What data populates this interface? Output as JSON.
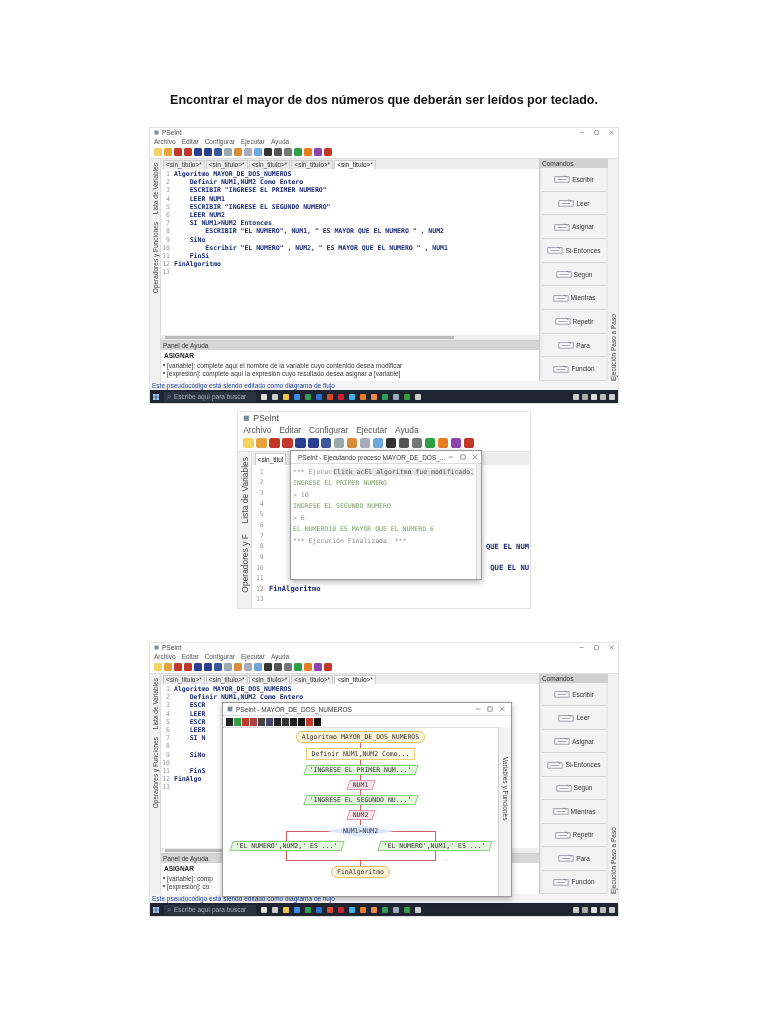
{
  "heading": "Encontrar el mayor de dos números que deberán ser leídos por teclado.",
  "screenshots": [
    {
      "window_title": "PSeInt",
      "menu": [
        "Archivo",
        "Editar",
        "Configurar",
        "Ejecutar",
        "Ayuda"
      ],
      "tabs": [
        {
          "label": "<sin_titulo>*",
          "selected": false
        },
        {
          "label": "<sin_titulo>*",
          "selected": false
        },
        {
          "label": "<sin_titulo>*",
          "selected": false
        },
        {
          "label": "<sin_titulo>*",
          "selected": false
        },
        {
          "label": "<sin_titulo>*",
          "selected": true
        }
      ],
      "left_strip": [
        "Lista de Variables",
        "Operadores y Funciones"
      ],
      "code_lines": [
        {
          "number": "1",
          "text": "Algoritmo MAYOR_DE_DOS_NUMEROS"
        },
        {
          "number": "2",
          "text": "    Definir NUM1,NUM2 Como Entero"
        },
        {
          "number": "3",
          "text": "    ESCRIBIR \"INGRESE EL PRIMER NUMERO\""
        },
        {
          "number": "4",
          "text": "    LEER NUM1"
        },
        {
          "number": "5",
          "text": "    ESCRIBIR \"INGRESE EL SEGUNDO NUMERO\""
        },
        {
          "number": "6",
          "text": "    LEER NUM2"
        },
        {
          "number": "7",
          "text": "    SI NUM1>NUM2 Entonces"
        },
        {
          "number": "8",
          "text": "        ESCRIBIR \"EL NUMERO\", NUM1, \" ES MAYOR QUE EL NUMERO \" , NUM2"
        },
        {
          "number": "9",
          "text": "    SiNo"
        },
        {
          "number": "10",
          "text": "        Escribir \"EL NUMERO\" , NUM2, \" ES MAYOR QUE EL NUMERO \" , NUM1"
        },
        {
          "number": "11",
          "text": "    FinSi"
        },
        {
          "number": "12",
          "text": "FinAlgoritmo"
        },
        {
          "number": "13"
        }
      ],
      "help": {
        "title": "Panel de Ayuda",
        "heading": "ASIGNAR",
        "items": [
          "[variable]: complete aquí el nombre de la variable cuyo contenido desea modificar",
          "[expresión]: complete aquí la expresión cuyo resultado desea asignar a [variable]"
        ]
      },
      "commands": {
        "title": "Comandos",
        "items": [
          "Escribir",
          "Leer",
          "Asignar",
          "Si-Entonces",
          "Según",
          "Mientras",
          "Repetir",
          "Para",
          "Función"
        ]
      },
      "right_strip": "Ejecución Paso a Paso",
      "status": "Este pseudocódigo está siendo editado como diagrama de flujo",
      "taskbar": {
        "search": "Escribe aquí para buscar"
      }
    },
    {
      "window_title": "PSeInt",
      "menu": [
        "Archivo",
        "Editar",
        "Configurar",
        "Ejecutar",
        "Ayuda"
      ],
      "tabs": [
        {
          "label": "<sin_titul",
          "selected": true
        }
      ],
      "left_strip": [
        "Lista de Variables",
        "Operadores y F"
      ],
      "code_lines": [
        {
          "number": "1"
        },
        {
          "number": "2"
        },
        {
          "number": "3"
        },
        {
          "number": "4"
        },
        {
          "number": "5"
        },
        {
          "number": "6"
        },
        {
          "number": "7"
        },
        {
          "number": "8",
          "text": "QUE EL NUM",
          "covered": true
        },
        {
          "number": "9"
        },
        {
          "number": "10",
          "text": "QUE EL NU",
          "covered": true
        },
        {
          "number": "11"
        },
        {
          "number": "12",
          "text": "FinAlgoritmo"
        },
        {
          "number": "13"
        }
      ],
      "run_window": {
        "title": "PSeInt - Ejecutando proceso MAYOR_DE_DOS_...",
        "lines": [
          {
            "kind": "banner",
            "text": "*** Ejecuc",
            "tooltip": "Click acEl algoritmo fue modificado."
          },
          {
            "kind": "output",
            "text": "INGRESE EL PRIMER NUMERO"
          },
          {
            "kind": "input",
            "text": "> 10"
          },
          {
            "kind": "output",
            "text": "INGRESE EL SEGUNDO NUMERO"
          },
          {
            "kind": "input",
            "text": "> 6"
          },
          {
            "kind": "output",
            "text": "EL NUMERO10 ES MAYOR QUE EL NUMERO 6"
          },
          {
            "kind": "banner",
            "text": "*** Ejecución Finalizada. ***"
          }
        ]
      }
    },
    {
      "window_title": "PSeInt",
      "menu": [
        "Archivo",
        "Editar",
        "Configurar",
        "Ejecutar",
        "Ayuda"
      ],
      "tabs": [
        {
          "label": "<sin_titulo>*",
          "selected": false
        },
        {
          "label": "<sin_titulo>*",
          "selected": false
        },
        {
          "label": "<sin_titulo>*",
          "selected": false
        },
        {
          "label": "<sin_titulo>*",
          "selected": false
        },
        {
          "label": "<sin_titulo>*",
          "selected": true
        }
      ],
      "left_strip": [
        "Lista de Variables",
        "Operadores y Funciones"
      ],
      "code_lines": [
        {
          "number": "1",
          "text": "Algoritmo MAYOR_DE_DOS_NUMEROS"
        },
        {
          "number": "2",
          "text": "    Definir NUM1,NUM2 Como Entero"
        },
        {
          "number": "3",
          "text": "    ESCR"
        },
        {
          "number": "4",
          "text": "    LEER"
        },
        {
          "number": "5",
          "text": "    ESCR"
        },
        {
          "number": "6",
          "text": "    LEER"
        },
        {
          "number": "7",
          "text": "    SI N"
        },
        {
          "number": "8"
        },
        {
          "number": "9",
          "text": "    SiNo"
        },
        {
          "number": "10"
        },
        {
          "number": "11",
          "text": "    FinS"
        },
        {
          "number": "12",
          "text": "FinAlgo"
        },
        {
          "number": "13"
        }
      ],
      "help": {
        "title": "Panel de Ayuda",
        "heading": "ASIGNAR",
        "items": [
          "[variable]: comp",
          "[expresión]: co"
        ]
      },
      "commands": {
        "title": "Comandos",
        "items": [
          "Escribir",
          "Leer",
          "Asignar",
          "Si-Entonces",
          "Según",
          "Mientras",
          "Repetir",
          "Para",
          "Función"
        ]
      },
      "right_strip": "Ejecución Paso a Paso",
      "status": "Este pseudocódigo está siendo editado como diagrama de flujo",
      "taskbar": {
        "search": "Escribe aquí para buscar"
      },
      "flow_window": {
        "title": "PSeInt - MAYOR_DE_DOS_NUMEROS",
        "side_label": "Variables y Funciones",
        "nodes": [
          {
            "kind": "start",
            "text": "Algoritmo MAYOR_DE_DOS_NUMEROS"
          },
          {
            "kind": "define",
            "text": "Definir NUM1,NUM2 Como..."
          },
          {
            "kind": "output",
            "text": "'INGRESE EL PRIMER NUM...'"
          },
          {
            "kind": "input",
            "text": "NUM1"
          },
          {
            "kind": "output",
            "text": "'INGRESE EL SEGUNDO NU...'"
          },
          {
            "kind": "input",
            "text": "NUM2"
          },
          {
            "kind": "decision",
            "text": "NUM1>NUM2",
            "branches": [
              {
                "kind": "output",
                "text": "'EL NUMERO',NUM2,' ES ...'"
              },
              {
                "kind": "output",
                "text": "'EL NUMERO',NUM1,' ES ...'"
              }
            ]
          },
          {
            "kind": "end",
            "text": "FinAlgoritmo"
          }
        ]
      }
    }
  ]
}
